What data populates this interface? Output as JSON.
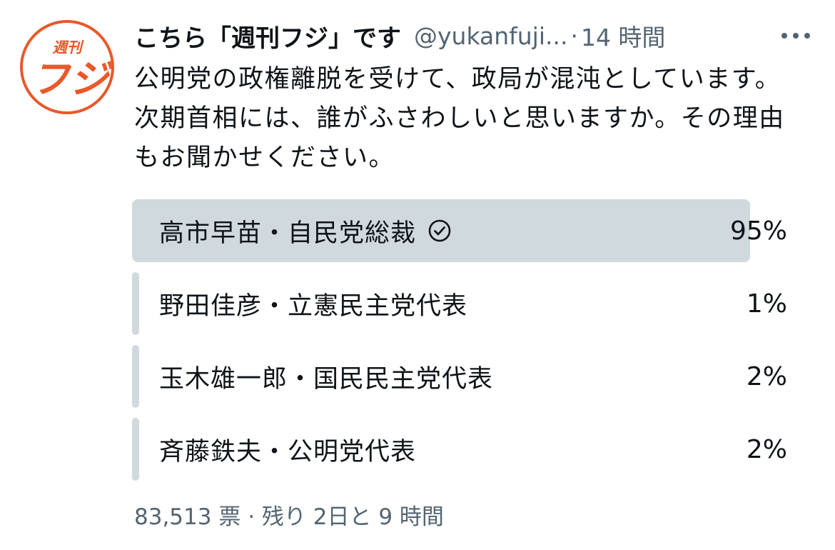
{
  "tweet": {
    "display_name": "こちら「週刊フジ」です",
    "handle": "@yukanfuji...",
    "separator": "·",
    "time": "14 時間",
    "text": "公明党の政権離脱を受けて、政局が混沌としています。次期首相には、誰がふさわしいと思いますか。その理由もお聞かせください。",
    "avatar": {
      "logo_top": "週刊",
      "logo_main": "フジ",
      "brand_color": "#e8592a"
    },
    "more_icon": "more-horizontal-icon"
  },
  "poll": {
    "options": [
      {
        "label": "高市早苗・自民党総裁",
        "percent_text": "95%",
        "percent": 95,
        "winner": true
      },
      {
        "label": "野田佳彦・立憲民主党代表",
        "percent_text": "1%",
        "percent": 1,
        "winner": false
      },
      {
        "label": "玉木雄一郎・国民民主党代表",
        "percent_text": "2%",
        "percent": 2,
        "winner": false
      },
      {
        "label": "斉藤鉄夫・公明党代表",
        "percent_text": "2%",
        "percent": 2,
        "winner": false
      }
    ],
    "votes": "83,513 票",
    "separator": "·",
    "remaining": "残り 2日と 9 時間",
    "winner_icon": "check-circle-icon",
    "colors": {
      "bar": "#cfd9de",
      "secondary_text": "#536471"
    }
  }
}
